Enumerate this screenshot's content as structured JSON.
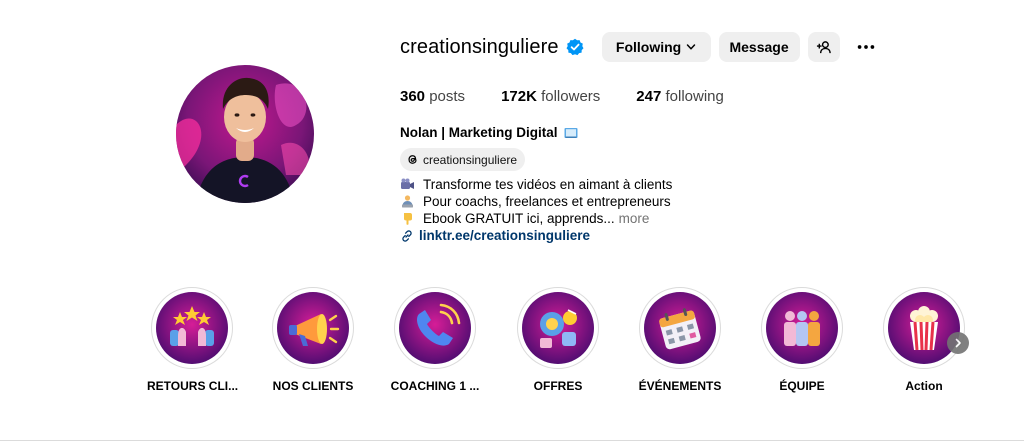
{
  "profile": {
    "username": "creationsinguliere",
    "verified_icon": "verified-badge-icon",
    "buttons": {
      "following": "Following",
      "message": "Message",
      "add_user_icon": "add-user-icon",
      "more_icon": "more-options-icon"
    },
    "stats": {
      "posts_count": "360",
      "posts_label": "posts",
      "followers_count": "172K",
      "followers_label": "followers",
      "following_count": "247",
      "following_label": "following"
    },
    "full_name": "Nolan | Marketing Digital",
    "threads_handle": "creationsinguliere",
    "bio": {
      "line1": "Transforme tes vidéos en aimant à clients",
      "line2": "Pour coachs, freelances et entrepreneurs",
      "line3": "Ebook GRATUIT ici, apprends...",
      "more": "more",
      "link": "linktr.ee/creationsinguliere"
    },
    "colors": {
      "accent_blue": "#0095f6",
      "link": "#00376b",
      "button_bg": "#efefef",
      "brand_pink": "#e0218a",
      "brand_purple": "#3a0a6b"
    }
  },
  "highlights": [
    {
      "label": "RETOURS CLI...",
      "icon": "stars-review-icon"
    },
    {
      "label": "NOS CLIENTS",
      "icon": "megaphone-icon"
    },
    {
      "label": "COACHING 1 ...",
      "icon": "phone-call-icon"
    },
    {
      "label": "OFFRES",
      "icon": "offers-icon"
    },
    {
      "label": "ÉVÉNEMENTS",
      "icon": "calendar-icon"
    },
    {
      "label": "ÉQUIPE",
      "icon": "team-icon"
    },
    {
      "label": "Action",
      "icon": "popcorn-icon"
    }
  ]
}
